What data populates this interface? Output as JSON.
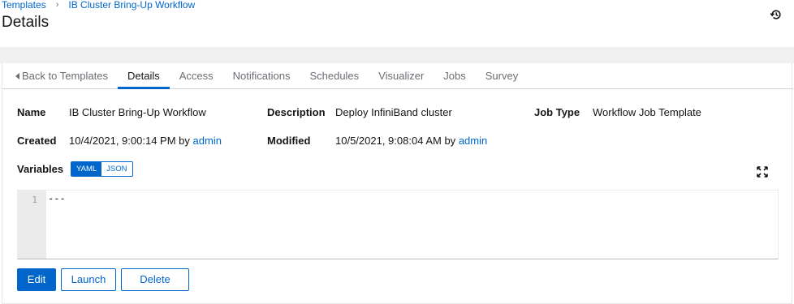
{
  "breadcrumb": {
    "root": "Templates",
    "current": "IB Cluster Bring-Up Workflow"
  },
  "page_title": "Details",
  "history_icon": "history-icon",
  "tabs": [
    {
      "label": "Back to Templates",
      "icon": "caret-left-icon"
    },
    {
      "label": "Details",
      "active": true
    },
    {
      "label": "Access"
    },
    {
      "label": "Notifications"
    },
    {
      "label": "Schedules"
    },
    {
      "label": "Visualizer"
    },
    {
      "label": "Jobs"
    },
    {
      "label": "Survey"
    }
  ],
  "details": {
    "name_label": "Name",
    "name_value": "IB Cluster Bring-Up Workflow",
    "description_label": "Description",
    "description_value": "Deploy InfiniBand cluster",
    "job_type_label": "Job Type",
    "job_type_value": "Workflow Job Template",
    "created_label": "Created",
    "created_date": "10/4/2021, 9:00:14 PM",
    "created_by_word": "by",
    "created_by_user": "admin",
    "modified_label": "Modified",
    "modified_date": "10/5/2021, 9:08:04 AM",
    "modified_by_word": "by",
    "modified_by_user": "admin",
    "variables_label": "Variables"
  },
  "variables_toggle": {
    "options": [
      "YAML",
      "JSON"
    ],
    "selected": "YAML"
  },
  "editor": {
    "line_numbers": [
      "1"
    ],
    "lines": [
      "---"
    ]
  },
  "actions": {
    "edit": "Edit",
    "launch": "Launch",
    "delete": "Delete"
  },
  "colors": {
    "accent": "#0066cc",
    "text": "#151515",
    "muted": "#6a6e73",
    "band": "#f0f0f0"
  }
}
